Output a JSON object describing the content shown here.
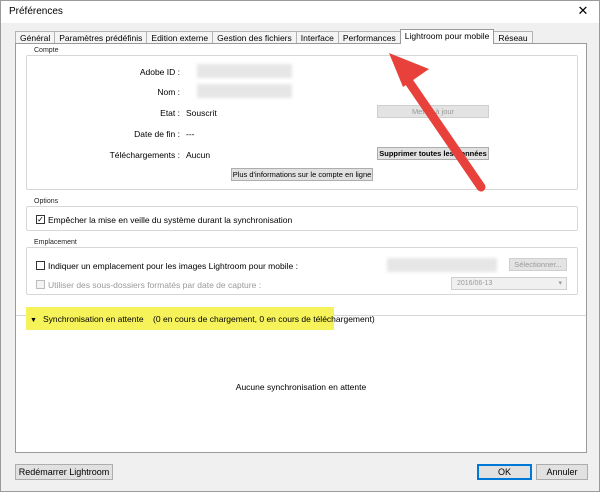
{
  "window": {
    "title": "Préférences",
    "close_glyph": "✕"
  },
  "tabs": [
    {
      "label": "Général"
    },
    {
      "label": "Paramètres prédéfinis"
    },
    {
      "label": "Edition externe"
    },
    {
      "label": "Gestion des fichiers"
    },
    {
      "label": "Interface"
    },
    {
      "label": "Performances"
    },
    {
      "label": "Lightroom pour mobile",
      "active": true
    },
    {
      "label": "Réseau"
    }
  ],
  "compte": {
    "title": "Compte",
    "adobe_id_label": "Adobe ID :",
    "nom_label": "Nom :",
    "etat_label": "Etat :",
    "etat_value": "Souscrit",
    "etat_button": "Mettre à jour",
    "date_fin_label": "Date de fin :",
    "date_fin_value": "---",
    "telechargements_label": "Téléchargements :",
    "telechargements_value": "Aucun",
    "supprimer_button": "Supprimer toutes les données",
    "info_button": "Plus d'informations sur le compte en ligne"
  },
  "options": {
    "title": "Options",
    "veille_label": "Empêcher la mise en veille du système durant la synchronisation",
    "veille_checked": true
  },
  "emplacement": {
    "title": "Emplacement",
    "indiquer_label": "Indiquer un emplacement pour les images Lightroom pour mobile :",
    "selectionner_button": "Sélectionner...",
    "sous_dossiers_label": "Utiliser des sous-dossiers formatés par date de capture :",
    "date_format_value": "2016/06-13"
  },
  "sync": {
    "toggle_glyph": "▼",
    "title": "Synchronisation en attente",
    "status": "(0 en cours de chargement, 0 en cours de téléchargement)",
    "empty_message": "Aucune synchronisation en attente"
  },
  "footer": {
    "restart_button": "Redémarrer Lightroom",
    "ok_button": "OK",
    "cancel_button": "Annuler"
  },
  "annotation": {
    "arrow_color": "#e8403a",
    "highlight_color": "#f6f35a"
  }
}
